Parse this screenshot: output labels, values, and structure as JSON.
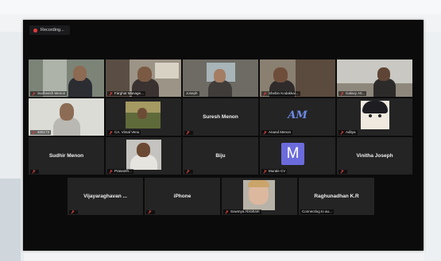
{
  "recording": {
    "label": "Recording..."
  },
  "participants": {
    "r1": [
      {
        "name": "Sudheesh Menon"
      },
      {
        "name": "Farghat Manage..."
      },
      {
        "name": "Joseph"
      },
      {
        "name": "Shebin Kodakkal..."
      },
      {
        "name": "Galaxy A0..."
      }
    ],
    "r2": [
      {
        "name": "405173"
      },
      {
        "name": "CA. Vimal Venu"
      },
      {
        "name": "",
        "center": "Suresh Menon"
      },
      {
        "name": "Anand Menon",
        "avatar_text": "AM"
      },
      {
        "name": "Aditya"
      }
    ],
    "r3": [
      {
        "name": "",
        "center": "Sudhir Menon"
      },
      {
        "name": "Prasanth..."
      },
      {
        "name": "",
        "center": "Biju"
      },
      {
        "name": "Murale CV",
        "avatar_text": "M"
      },
      {
        "name": "",
        "center": "Vinitha Joseph"
      }
    ],
    "r4": [
      {
        "name": "",
        "center": "Vijayaraghavan ..."
      },
      {
        "name": "",
        "center": "iPhone"
      },
      {
        "name": "Sowmya Abraham"
      },
      {
        "name": "Connecting to au...",
        "center": "Raghunadhan K.R"
      }
    ]
  },
  "colors": {
    "window_bg": "#0b0b0c",
    "tile_bg": "#242424",
    "active_border": "#b7d35a",
    "muted_mic": "#d23c3c",
    "avatar_m": "#6c6bdc",
    "avatar_am": "#6d8be8"
  }
}
